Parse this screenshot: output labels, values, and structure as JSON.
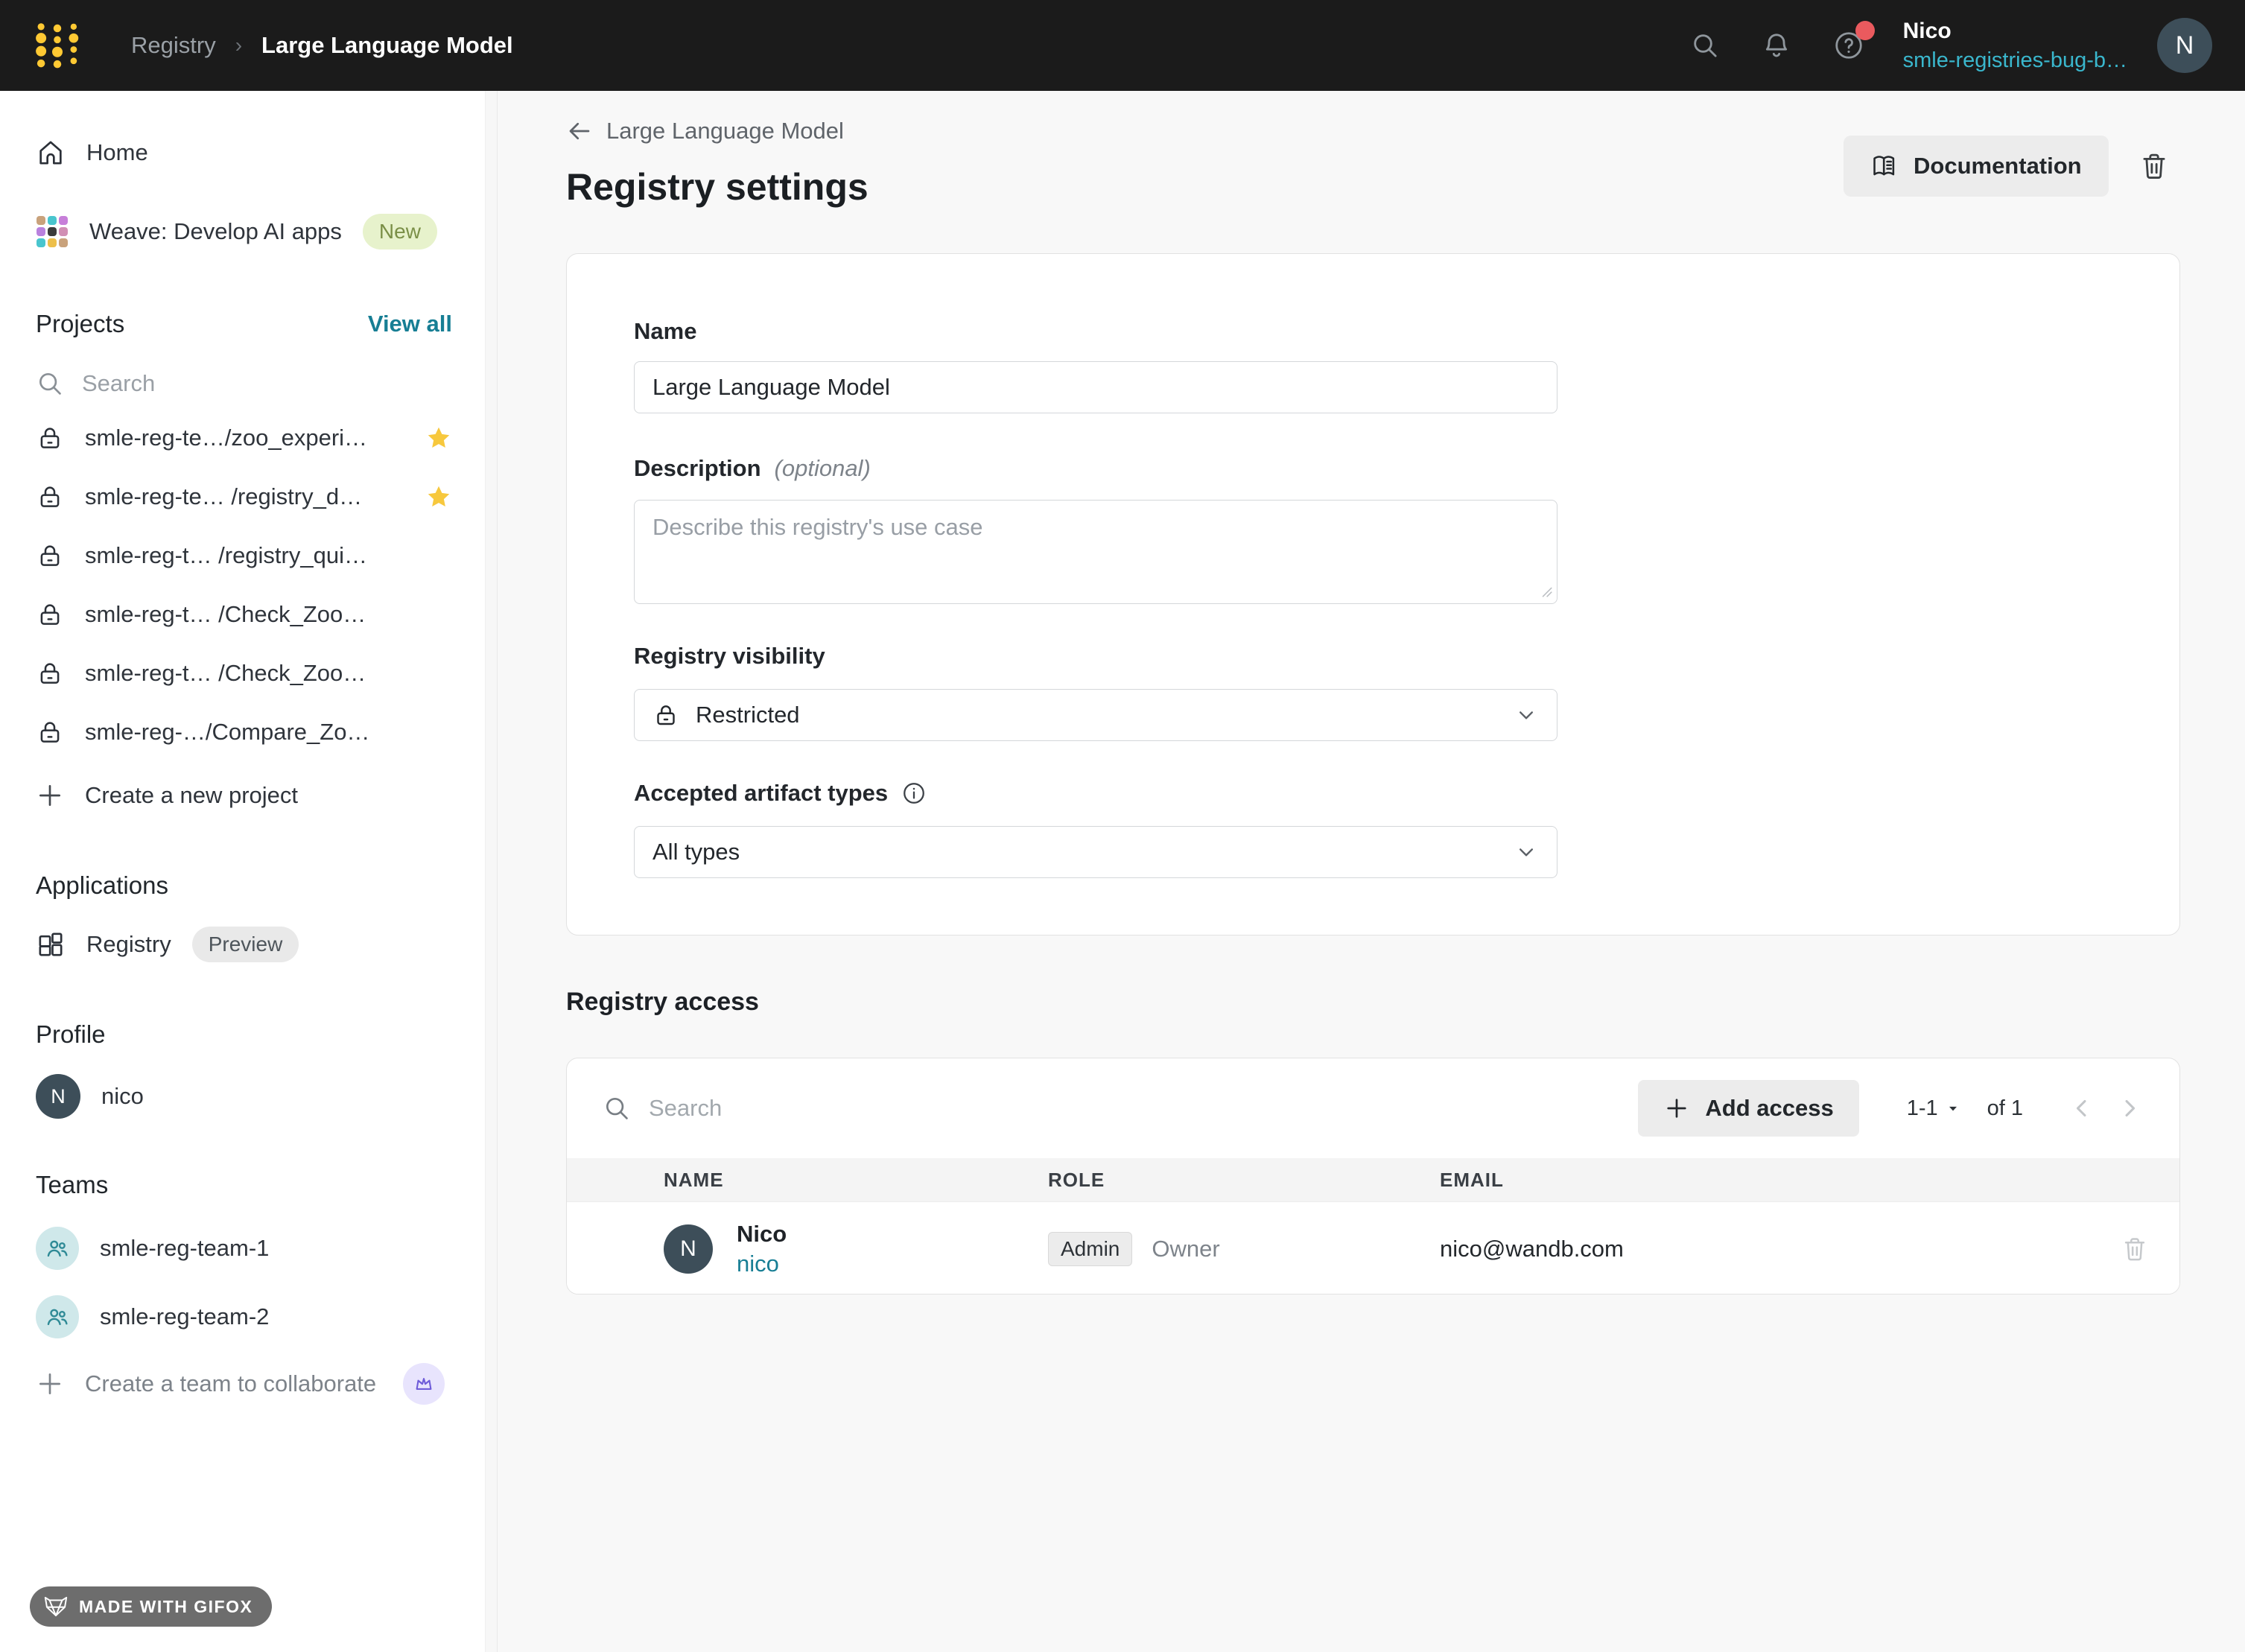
{
  "topbar": {
    "breadcrumb": {
      "root": "Registry",
      "separator": "›",
      "current": "Large Language Model"
    },
    "user": {
      "name": "Nico",
      "team": "smle-registries-bug-b…",
      "avatar_initial": "N"
    }
  },
  "sidebar": {
    "home_label": "Home",
    "weave": {
      "label": "Weave: Develop AI apps",
      "badge": "New"
    },
    "projects": {
      "title": "Projects",
      "view_all": "View all",
      "search_placeholder": "Search",
      "items": [
        {
          "label": "smle-reg-te…/zoo_experi…",
          "starred": true
        },
        {
          "label": "smle-reg-te… /registry_d…",
          "starred": true
        },
        {
          "label": "smle-reg-t… /registry_qui…",
          "starred": false
        },
        {
          "label": "smle-reg-t… /Check_Zoo…",
          "starred": false
        },
        {
          "label": "smle-reg-t… /Check_Zoo…",
          "starred": false
        },
        {
          "label": "smle-reg-…/Compare_Zo…",
          "starred": false
        }
      ],
      "create_label": "Create a new project"
    },
    "applications": {
      "title": "Applications",
      "registry_label": "Registry",
      "registry_badge": "Preview"
    },
    "profile": {
      "title": "Profile",
      "user": "nico",
      "avatar_initial": "N"
    },
    "teams": {
      "title": "Teams",
      "items": [
        "smle-reg-team-1",
        "smle-reg-team-2"
      ],
      "create_label": "Create a team to collaborate"
    }
  },
  "main": {
    "back_label": "Large Language Model",
    "title": "Registry settings",
    "documentation_label": "Documentation",
    "form": {
      "name_label": "Name",
      "name_value": "Large Language Model",
      "description_label": "Description",
      "description_optional": "(optional)",
      "description_placeholder": "Describe this registry's use case",
      "visibility_label": "Registry visibility",
      "visibility_value": "Restricted",
      "artifact_types_label": "Accepted artifact types",
      "artifact_types_value": "All types"
    },
    "access": {
      "title": "Registry access",
      "search_placeholder": "Search",
      "add_button": "Add access",
      "pagination": {
        "range": "1-1",
        "of": "of 1"
      },
      "columns": [
        "NAME",
        "ROLE",
        "EMAIL"
      ],
      "rows": [
        {
          "name": "Nico",
          "username": "nico",
          "avatar_initial": "N",
          "role_badge": "Admin",
          "role": "Owner",
          "email": "nico@wandb.com"
        }
      ]
    }
  },
  "footer_badge": {
    "label": "MADE WITH GIFOX"
  },
  "colors": {
    "navbar_bg": "#1b1b1b",
    "accent_teal_link": "#177e94",
    "accent_teal_light": "#3ab7cd",
    "star_yellow": "#f7c83d",
    "notification_red": "#ea5a5e",
    "avatar_slate": "#3d4e59",
    "badge_new_bg": "#e7f2cc",
    "badge_new_text": "#7a8f47",
    "main_bg": "#f8f8f8"
  }
}
